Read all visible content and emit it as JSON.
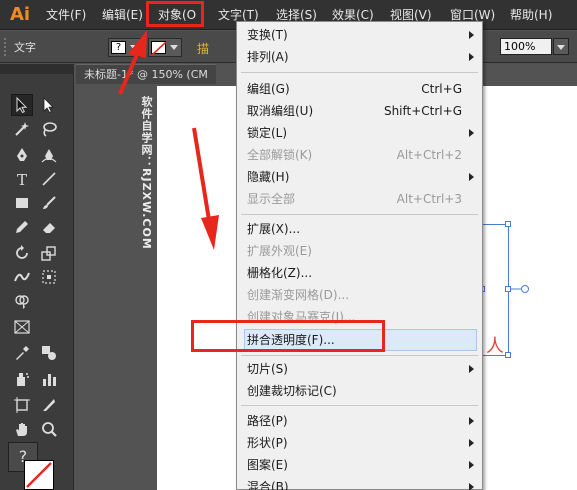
{
  "app": {
    "logo": "Ai"
  },
  "menubar": {
    "items": [
      {
        "id": "file",
        "label": "文件(F)"
      },
      {
        "id": "edit",
        "label": "编辑(E)"
      },
      {
        "id": "object",
        "label": "对象(O"
      },
      {
        "id": "type",
        "label": "文字(T)"
      },
      {
        "id": "select",
        "label": "选择(S)"
      },
      {
        "id": "effect",
        "label": "效果(C)"
      },
      {
        "id": "view",
        "label": "视图(V)"
      },
      {
        "id": "window",
        "label": "窗口(W)"
      },
      {
        "id": "help",
        "label": "帮助(H)"
      }
    ]
  },
  "controlbar": {
    "label": "文字",
    "fill_glyph": "?",
    "yellow_text": "描",
    "opacity": "100%"
  },
  "document": {
    "tab_title": "未标题-1* @ 150% (CM",
    "watermark": "软件自学网：RJZXW.COM",
    "artboard_text": "人"
  },
  "toolbox": {
    "fill_glyph": "?"
  },
  "object_menu": {
    "items": [
      {
        "label": "变换(T)",
        "shortcut": "",
        "submenu": true,
        "disabled": false
      },
      {
        "label": "排列(A)",
        "shortcut": "",
        "submenu": true,
        "disabled": false
      },
      {
        "label": "编组(G)",
        "shortcut": "Ctrl+G",
        "submenu": false,
        "disabled": false
      },
      {
        "label": "取消编组(U)",
        "shortcut": "Shift+Ctrl+G",
        "submenu": false,
        "disabled": false
      },
      {
        "label": "锁定(L)",
        "shortcut": "",
        "submenu": true,
        "disabled": false
      },
      {
        "label": "全部解锁(K)",
        "shortcut": "Alt+Ctrl+2",
        "submenu": false,
        "disabled": true
      },
      {
        "label": "隐藏(H)",
        "shortcut": "",
        "submenu": true,
        "disabled": false
      },
      {
        "label": "显示全部",
        "shortcut": "Alt+Ctrl+3",
        "submenu": false,
        "disabled": true
      },
      {
        "label": "扩展(X)...",
        "shortcut": "",
        "submenu": false,
        "disabled": false
      },
      {
        "label": "扩展外观(E)",
        "shortcut": "",
        "submenu": false,
        "disabled": true
      },
      {
        "label": "栅格化(Z)...",
        "shortcut": "",
        "submenu": false,
        "disabled": false
      },
      {
        "label": "创建渐变网格(D)...",
        "shortcut": "",
        "submenu": false,
        "disabled": true
      },
      {
        "label": "创建对象马赛克(J)...",
        "shortcut": "",
        "submenu": false,
        "disabled": true
      },
      {
        "label": "拼合透明度(F)...",
        "shortcut": "",
        "submenu": false,
        "disabled": false
      },
      {
        "label": "切片(S)",
        "shortcut": "",
        "submenu": true,
        "disabled": false
      },
      {
        "label": "创建裁切标记(C)",
        "shortcut": "",
        "submenu": false,
        "disabled": false
      },
      {
        "label": "路径(P)",
        "shortcut": "",
        "submenu": true,
        "disabled": false
      },
      {
        "label": "形状(P)",
        "shortcut": "",
        "submenu": true,
        "disabled": false
      },
      {
        "label": "图案(E)",
        "shortcut": "",
        "submenu": true,
        "disabled": false
      },
      {
        "label": "混合(B)",
        "shortcut": "",
        "submenu": true,
        "disabled": false
      }
    ]
  },
  "colors": {
    "annotation_red": "#e8271c",
    "highlight": "#dceaf8",
    "logo_orange": "#f08a24"
  }
}
